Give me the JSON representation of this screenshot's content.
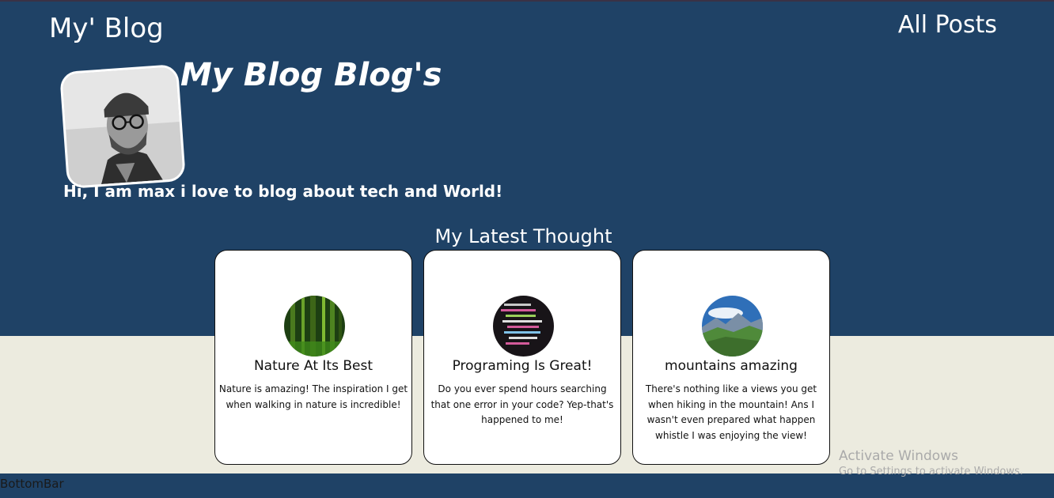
{
  "header": {
    "brand": "My' Blog",
    "nav_all_posts": "All Posts"
  },
  "hero": {
    "title": "My Blog Blog's",
    "bio": "Hi, I am max i love to blog about tech and World!"
  },
  "latest": {
    "heading": "My Latest Thought",
    "posts": [
      {
        "title": "Nature At Its Best",
        "excerpt": "Nature is amazing! The inspiration I get when walking in nature is incredible!",
        "image": "forest-thumbnail"
      },
      {
        "title": "Programing Is Great!",
        "excerpt": "Do you ever spend hours searching that one error in your code? Yep-that's happened to me!",
        "image": "code-screen-thumbnail"
      },
      {
        "title": "mountains amazing",
        "excerpt": "There's nothing like a views you get when hiking in the mountain! Ans I wasn't even prepared what happen whistle I was enjoying the view!",
        "image": "mountain-thumbnail"
      }
    ]
  },
  "footer": {
    "label": "BottomBar"
  },
  "watermark": {
    "line1": "Activate Windows",
    "line2": "Go to Settings to activate Windows."
  },
  "colors": {
    "header_bg": "#1f4266",
    "page_bg": "#ecebdf",
    "card_bg": "#ffffff"
  }
}
